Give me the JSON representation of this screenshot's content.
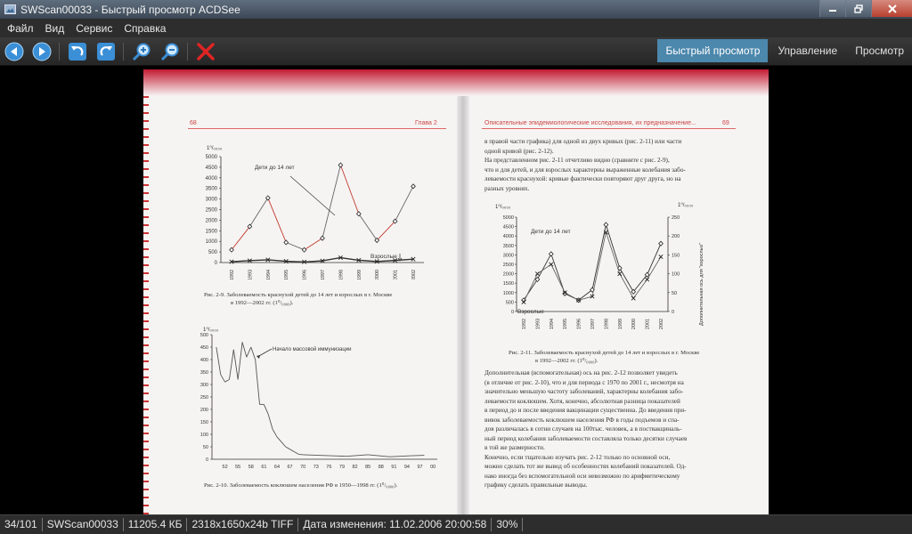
{
  "window": {
    "title": "SWScan00033 - Быстрый просмотр ACDSee"
  },
  "menu": {
    "file": "Файл",
    "view": "Вид",
    "service": "Сервис",
    "help": "Справка"
  },
  "toolbar": {
    "icons": [
      "back-icon",
      "forward-icon",
      "rotate-left-icon",
      "rotate-right-icon",
      "zoom-in-icon",
      "zoom-out-icon",
      "delete-icon"
    ],
    "modes": {
      "quick_view": "Быстрый просмотр",
      "manage": "Управление",
      "view": "Просмотр"
    }
  },
  "document": {
    "left_page_number": "68",
    "left_header": "Глава 2",
    "right_header": "Описательные эпидемиологические исследования, их предназначение...",
    "right_page_number": "69",
    "fig9": {
      "unit": "1⁰/₀₀₀₀",
      "label_children": "Дети до 14 лет",
      "label_adults": "Взрослые",
      "caption_lines": [
        "Рис. 2-9. Заболеваемость краснухой детей до 14 лет и взрослых в г. Москве",
        "в 1992—2002 гг. (1⁰/₀₀₀₀)."
      ]
    },
    "fig10": {
      "unit": "1⁰/₀₀₀₀",
      "annotation": "Начало массовой иммунизации",
      "caption": "Рис. 2-10. Заболеваемость коклюшем населения РФ в 1950—1998 гг. (1⁰/₀₀₀₀)."
    },
    "fig11": {
      "unit": "1⁰/₀₀₀₀",
      "label_children": "Дети до 14 лет",
      "label_adults": "Взрослые",
      "secondary_axis_label": "Дополнительная ось для \"взрослых\"",
      "caption_lines": [
        "Рис. 2-11. Заболеваемость краснухой детей до 14 лет и взрослых в г. Москве",
        "в 1992—2002 гг. (1⁰/₀₀₀₀)."
      ]
    },
    "right_text_top": [
      "в правой части графика) для одной из двух кривых (рис. 2-11) или части",
      "одной кривой (рис. 2-12).",
      "    На представленном рис. 2-11 отчетливо видно (сравните с рис. 2-9),",
      "что и для детей, и для взрослых характерны выраженные колебания забо-",
      "леваемости краснухой: кривые фактически повторяют друг друга, но на",
      "разных уровнях."
    ],
    "right_text_bottom": [
      "    Дополнительная (вспомогательная) ось на рис. 2-12 позволяет увидеть",
      "(в отличие от рис. 2-10), что и для периода с 1970 по 2001 г., несмотря на",
      "значительно меньшую частоту заболеваний, характерны колебания забо-",
      "леваемости коклюшем. Хотя, конечно, абсолютная разница показателей",
      "в период до и после введения вакцинации существенна. До введения при-",
      "вивок заболеваемость коклюшем населения РФ в годы подъемов и спа-",
      "дов различалась в сотни случаев на 100тыс. человек, а в поствакциналь-",
      "ный период колебания заболеваемости составляла только десятки случаев",
      "в той же размерности.",
      "    Конечно, если тщательно изучать рис. 2-12 только по основной оси,",
      "можно сделать тот же вывод об особенностях колебаний показателей. Од-",
      "нако иногда без вспомогательной оси невозможно по арифметическому",
      "графику сделать правильные выводы."
    ]
  },
  "status": {
    "index": "34/101",
    "filename": "SWScan00033",
    "size": "11205.4 КБ",
    "format": "2318x1650x24b TIFF",
    "date": "Дата изменения: 11.02.2006 20:00:58",
    "zoom": "30%"
  },
  "chart_data": [
    {
      "type": "line",
      "title": "Рис. 2-9",
      "x": [
        "1992",
        "1993",
        "1994",
        "1995",
        "1996",
        "1997",
        "1998",
        "1999",
        "2000",
        "2001",
        "2002"
      ],
      "ylim": [
        0,
        5000
      ],
      "yticks": [
        0,
        500,
        1000,
        1500,
        2000,
        2500,
        3000,
        3500,
        4000,
        4500,
        5000
      ],
      "series": [
        {
          "name": "Дети до 14 лет",
          "values": [
            600,
            1700,
            3050,
            950,
            600,
            1150,
            4600,
            2300,
            1050,
            1950,
            3600
          ]
        },
        {
          "name": "Взрослые",
          "values": [
            40,
            90,
            130,
            60,
            30,
            80,
            230,
            110,
            50,
            100,
            160
          ]
        }
      ]
    },
    {
      "type": "line",
      "title": "Рис. 2-10",
      "xticks": [
        "52",
        "55",
        "58",
        "61",
        "64",
        "67",
        "70",
        "73",
        "76",
        "79",
        "82",
        "85",
        "88",
        "91",
        "94",
        "97",
        "00"
      ],
      "ylim": [
        0,
        500
      ],
      "yticks": [
        0,
        50,
        100,
        150,
        200,
        250,
        300,
        350,
        400,
        450,
        500
      ],
      "x": [
        1950,
        1951,
        1952,
        1953,
        1954,
        1955,
        1956,
        1957,
        1958,
        1959,
        1960,
        1961,
        1962,
        1963,
        1964,
        1965,
        1966,
        1967,
        1968,
        1969,
        1970,
        1975,
        1980,
        1985,
        1990,
        1995,
        1998
      ],
      "series": [
        {
          "name": "",
          "values": [
            450,
            340,
            310,
            320,
            440,
            320,
            470,
            410,
            450,
            400,
            220,
            220,
            180,
            120,
            90,
            70,
            50,
            40,
            30,
            20,
            18,
            15,
            12,
            18,
            10,
            14,
            16
          ]
        }
      ]
    },
    {
      "type": "line",
      "title": "Рис. 2-11",
      "x": [
        "1992",
        "1993",
        "1994",
        "1995",
        "1996",
        "1997",
        "1998",
        "1999",
        "2000",
        "2001",
        "2002"
      ],
      "ylim": [
        0,
        5000
      ],
      "yticks": [
        0,
        500,
        1000,
        1500,
        2000,
        2500,
        3000,
        3500,
        4000,
        4500,
        5000
      ],
      "y2lim": [
        0,
        250
      ],
      "y2ticks": [
        0,
        50,
        100,
        150,
        200,
        250
      ],
      "series": [
        {
          "name": "Дети до 14 лет",
          "values": [
            600,
            1700,
            3050,
            950,
            600,
            1150,
            4600,
            2300,
            1050,
            1950,
            3600
          ]
        },
        {
          "name": "Взрослые",
          "axis": "secondary",
          "values": [
            25,
            100,
            125,
            50,
            30,
            40,
            210,
            100,
            35,
            85,
            145
          ]
        }
      ]
    }
  ]
}
